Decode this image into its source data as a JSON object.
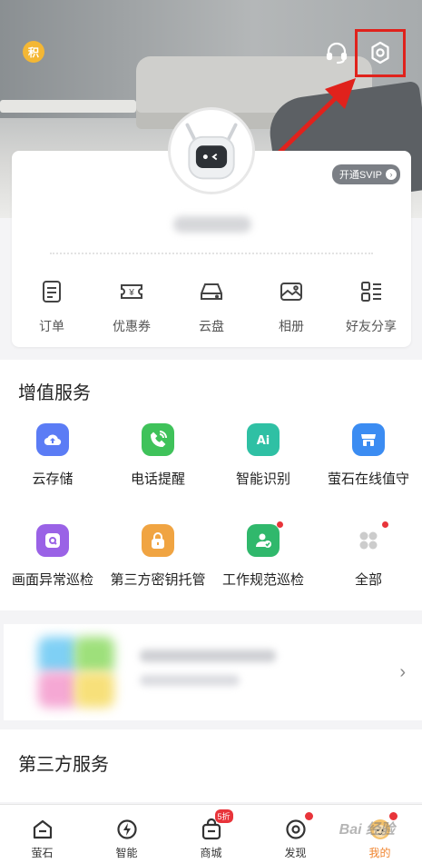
{
  "header": {
    "points_badge": "积",
    "icons": [
      "customer-service-icon",
      "settings-icon"
    ]
  },
  "profile_card": {
    "svip_label": "开通SVIP",
    "actions": [
      {
        "label": "订单",
        "icon": "order-icon"
      },
      {
        "label": "优惠券",
        "icon": "coupon-icon"
      },
      {
        "label": "云盘",
        "icon": "cloud-disk-icon"
      },
      {
        "label": "相册",
        "icon": "album-icon"
      },
      {
        "label": "好友分享",
        "icon": "friend-share-icon"
      }
    ]
  },
  "value_added": {
    "title": "增值服务",
    "items": [
      {
        "label": "云存储",
        "icon": "cloud-upload-icon",
        "color": "#5b7cf5"
      },
      {
        "label": "电话提醒",
        "icon": "phone-icon",
        "color": "#3fc25a"
      },
      {
        "label": "智能识别",
        "icon": "ai-icon",
        "color": "#2fc0a4"
      },
      {
        "label": "萤石在线值守",
        "icon": "store-icon",
        "color": "#3b8cf2"
      },
      {
        "label": "画面异常巡检",
        "icon": "camera-scan-icon",
        "color": "#9a62e6"
      },
      {
        "label": "第三方密钥托管",
        "icon": "lock-icon",
        "color": "#f0a442"
      },
      {
        "label": "工作规范巡检",
        "icon": "user-check-icon",
        "color": "#30b86c"
      },
      {
        "label": "全部",
        "icon": "grid-icon",
        "color": "#cccccc"
      }
    ]
  },
  "third_party": {
    "title": "第三方服务"
  },
  "tabbar": {
    "tabs": [
      {
        "label": "萤石",
        "icon": "home-icon"
      },
      {
        "label": "智能",
        "icon": "smart-icon"
      },
      {
        "label": "商城",
        "icon": "shop-icon",
        "badge": "5折"
      },
      {
        "label": "发现",
        "icon": "discover-icon"
      },
      {
        "label": "我的",
        "icon": "mine-icon"
      }
    ]
  },
  "watermark": "Bai 经验"
}
